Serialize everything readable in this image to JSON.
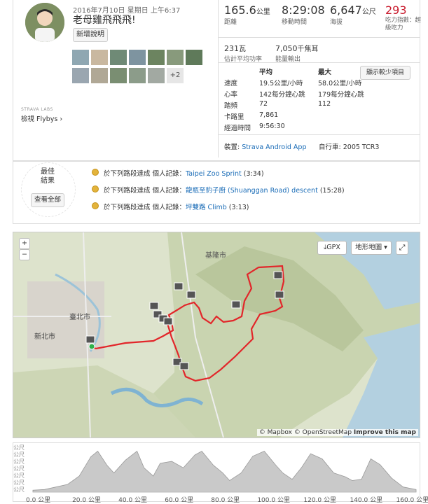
{
  "activity": {
    "date": "2016年7月10日 星期日 上午6:37",
    "title": "老母雞飛飛飛!",
    "add_description": "新增說明",
    "photos_more": "+2",
    "strava_labs": "STRAVA LABS",
    "flyby_prefix": "檢視 ",
    "flyby_link": "Flybys ›"
  },
  "stats": {
    "distance_value": "165.6",
    "distance_unit": "公里",
    "distance_label": "距離",
    "moving_time_value": "8:29:08",
    "moving_time_label": "移動時間",
    "elevation_value": "6,647",
    "elevation_unit": "公尺",
    "elevation_label": "海拔",
    "suffer_value": "293",
    "suffer_label": "吃力指數：超級吃力",
    "power_value": "231",
    "power_unit": "瓦",
    "power_label": "估計平均功率",
    "energy_value": "7,050",
    "energy_unit": "千焦耳",
    "energy_label": "能量輸出"
  },
  "table": {
    "col_avg": "平均",
    "col_max": "最大",
    "show_less": "顯示較少項目",
    "rows": [
      {
        "label": "速度",
        "avg": "19.5公里/小時",
        "max": "58.0公里/小時"
      },
      {
        "label": "心率",
        "avg": "142每分鐘心跳",
        "max": "179每分鐘心跳"
      },
      {
        "label": "踏頻",
        "avg": "72",
        "max": "112"
      },
      {
        "label": "卡路里",
        "avg": "7,861",
        "max": ""
      },
      {
        "label": "經過時間",
        "avg": "9:56:30",
        "max": ""
      }
    ],
    "device_label": "裝置:",
    "device_value": "Strava Android App",
    "bike_label": "自行車:",
    "bike_value": "2005 TCR3"
  },
  "achievements": {
    "best_line1": "最佳",
    "best_line2": "結果",
    "view_all": "查看全部",
    "prefix": "於下列路段達成 個人記錄：",
    "items": [
      {
        "segment": "Taipei Zoo Sprint",
        "time": "(3:34)"
      },
      {
        "segment": "龍瓶至豹子廚 (Shuanggan Road) descent",
        "time": "(15:28)"
      },
      {
        "segment": "坪雙路 Climb",
        "time": "(3:13)"
      }
    ]
  },
  "map": {
    "zoom_in": "+",
    "zoom_out": "−",
    "gpx": "GPX",
    "map_type": "地形地圖 ▾",
    "expand_icon": "expand-icon",
    "city_keelung": "基隆市",
    "city_taipei": "臺北市",
    "city_newtaipei": "新北市",
    "attribution_mapbox": "© Mapbox",
    "attribution_osm": "© OpenStreetMap",
    "attribution_improve": "Improve this map"
  },
  "elevation_chart": {
    "y_unit": "公尺",
    "x_ticks": [
      "0.0 公里",
      "20.0 公里",
      "40.0 公里",
      "60.0 公里",
      "80.0 公里",
      "100.0 公里",
      "120.0 公里",
      "140.0 公里",
      "160.0 公里"
    ]
  },
  "chart_data": {
    "type": "area",
    "xlabel": "",
    "ylabel": "",
    "x_unit": "公里",
    "xlim": [
      0,
      165.6
    ],
    "x": [
      0,
      5,
      10,
      15,
      20,
      25,
      28,
      32,
      35,
      40,
      45,
      48,
      52,
      55,
      60,
      65,
      70,
      73,
      78,
      82,
      85,
      90,
      95,
      100,
      105,
      108,
      112,
      116,
      120,
      125,
      130,
      135,
      138,
      142,
      146,
      150,
      155,
      160,
      165.6
    ],
    "y": [
      30,
      40,
      80,
      120,
      250,
      550,
      640,
      420,
      300,
      500,
      640,
      380,
      250,
      450,
      480,
      380,
      580,
      640,
      420,
      300,
      180,
      300,
      560,
      640,
      420,
      300,
      200,
      380,
      600,
      520,
      300,
      240,
      180,
      200,
      520,
      430,
      220,
      80,
      40
    ],
    "grid": false
  },
  "colors": {
    "route": "#e2262a",
    "link": "#1a6cb7",
    "suffer": "#c8192b",
    "elevation_fill": "#c9c9c9"
  }
}
